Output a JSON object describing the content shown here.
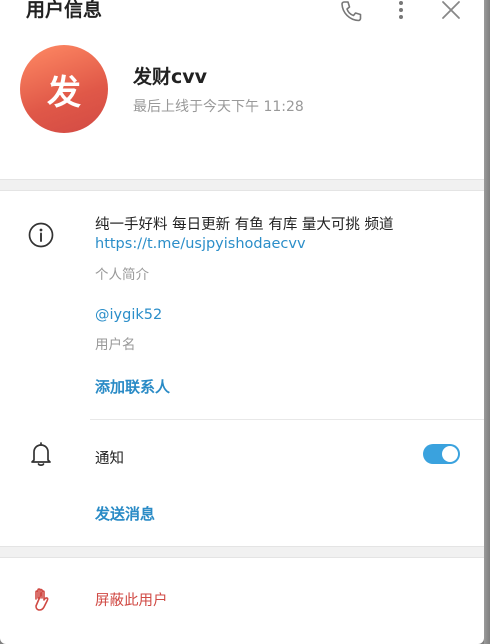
{
  "header": {
    "title": "用户信息"
  },
  "profile": {
    "avatar_letter": "发",
    "name": "发财cvv",
    "last_seen": "最后上线于今天下午 11:28"
  },
  "info": {
    "bio": "纯一手好料 每日更新 有鱼 有库 量大可挑 频道",
    "bio_link": "https://t.me/usjpyishodaecvv",
    "bio_label": "个人简介",
    "username": "@iygik52",
    "username_label": "用户名",
    "add_contact": "添加联系人"
  },
  "notifications": {
    "label": "通知",
    "enabled": true
  },
  "actions": {
    "send_message": "发送消息",
    "block_user": "屏蔽此用户"
  },
  "colors": {
    "accent": "#2a8bc6",
    "toggle": "#3aa2de",
    "danger": "#d04a44",
    "avatar_gradient_start": "#ff8a64",
    "avatar_gradient_end": "#d24a44"
  }
}
